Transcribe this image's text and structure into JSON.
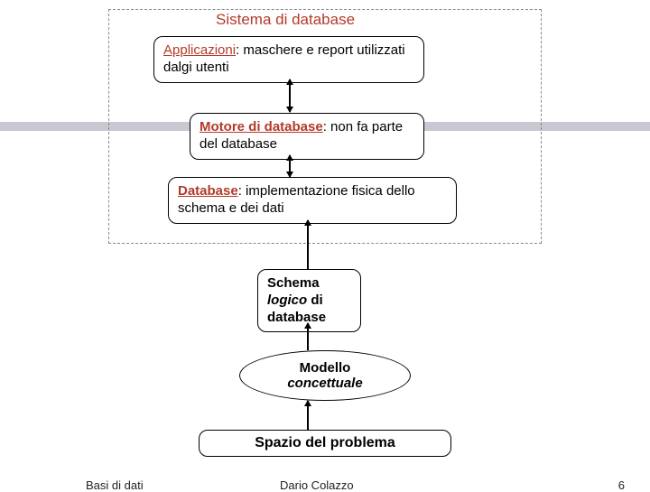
{
  "diagram": {
    "container_title": "Sistema di database",
    "applicazioni": {
      "title": "Applicazioni",
      "desc": ": maschere e report utilizzati dalgi utenti"
    },
    "motore": {
      "title": "Motore di database",
      "desc": ": non fa parte del database"
    },
    "database": {
      "title": "Database",
      "desc": ": implementazione fisica dello schema e dei dati"
    },
    "schema": {
      "line1": "Schema",
      "line2_italic": "logico",
      "line2_rest": " di",
      "line3": "database"
    },
    "modello": {
      "line1": "Modello",
      "line2": "concettuale"
    },
    "problema": "Spazio del problema"
  },
  "footer": {
    "left": "Basi di dati",
    "center": "Dario Colazzo",
    "page": "6"
  }
}
